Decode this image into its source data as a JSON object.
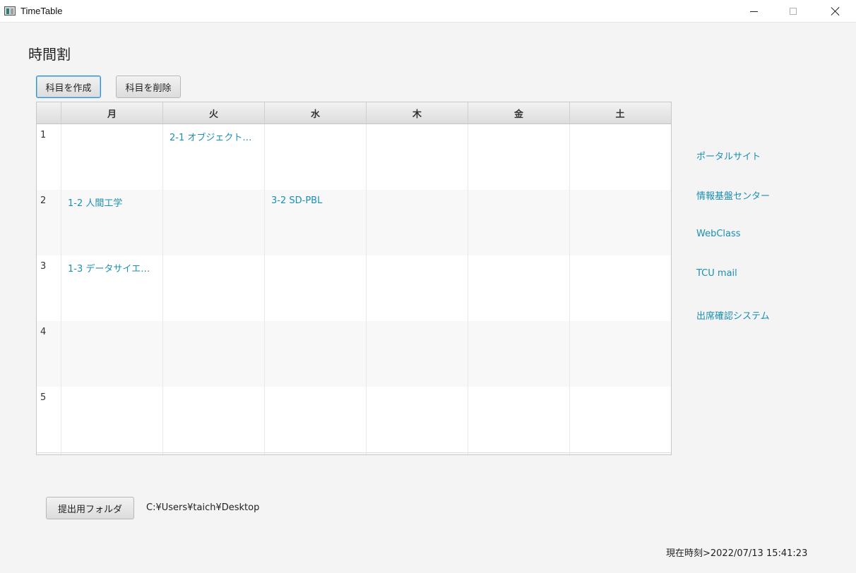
{
  "window": {
    "title": "TimeTable",
    "controls": {
      "minimize": "minimize",
      "maximize": "maximize",
      "close": "close"
    }
  },
  "header": {
    "title": "時間割"
  },
  "toolbar": {
    "create_label": "科目を作成",
    "delete_label": "科目を削除"
  },
  "timetable": {
    "days": [
      "月",
      "火",
      "水",
      "木",
      "金",
      "土"
    ],
    "rows": [
      {
        "period": "1",
        "cells": [
          "",
          "2-1 オブジェクト指...",
          "",
          "",
          "",
          ""
        ]
      },
      {
        "period": "2",
        "cells": [
          "1-2 人間工学",
          "",
          "3-2 SD-PBL",
          "",
          "",
          ""
        ]
      },
      {
        "period": "3",
        "cells": [
          "1-3 データサイエン...",
          "",
          "",
          "",
          "",
          ""
        ]
      },
      {
        "period": "4",
        "cells": [
          "",
          "",
          "",
          "",
          "",
          ""
        ]
      },
      {
        "period": "5",
        "cells": [
          "",
          "",
          "",
          "",
          "",
          ""
        ]
      }
    ]
  },
  "links": [
    {
      "label": "ポータルサイト"
    },
    {
      "label": "情報基盤センター"
    },
    {
      "label": "WebClass"
    },
    {
      "label": "TCU mail"
    },
    {
      "label": "出席確認システム"
    }
  ],
  "footer": {
    "folder_button_label": "提出用フォルダ",
    "folder_path": "C:¥Users¥taich¥Desktop",
    "clock_text": "現在時刻>2022/07/13 15:41:23"
  },
  "colors": {
    "link": "#1a8fb5",
    "focus_border": "#2f8fd9",
    "background": "#f4f4f4"
  }
}
